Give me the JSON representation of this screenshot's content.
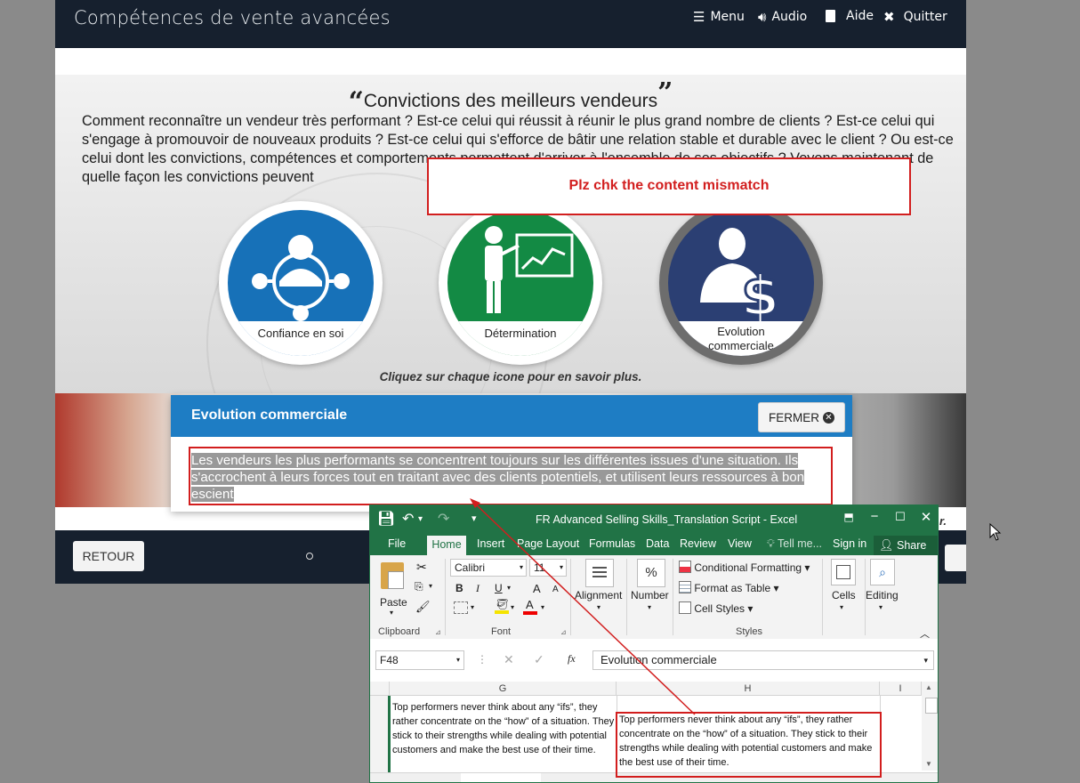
{
  "course": {
    "title": "Compétences de vente avancées",
    "nav": [
      {
        "icon": "list-icon",
        "label": "Menu"
      },
      {
        "icon": "speaker-icon",
        "label": "Audio"
      },
      {
        "icon": "book-icon",
        "label": "Aide"
      },
      {
        "icon": "close-x-icon",
        "label": "Quitter"
      }
    ]
  },
  "slide": {
    "title": "Convictions des meilleurs vendeurs",
    "quote_open": "“",
    "quote_close": "”",
    "body": "Comment reconnaître un vendeur très performant ? Est-ce celui qui réussit à réunir le plus grand nombre de clients ? Est-ce celui qui s'engage à promouvoir de nouveaux produits ? Est-ce celui qui s'efforce de bâtir une relation stable et durable avec le client ? Ou est-ce celui dont les convictions, compétences et comportements permettent d'arriver à l'ensemble de ses objectifs ? Voyons maintenant de quelle façon les convictions peuvent",
    "circles": [
      {
        "label": "Confiance en soi",
        "color": "#1771b8",
        "icon": "network-person-icon"
      },
      {
        "label": "Détermination",
        "color": "#138a44",
        "icon": "presenter-chart-icon"
      },
      {
        "label": "Evolution\ncommerciale",
        "color": "#2b3f73",
        "icon": "person-dollar-icon"
      }
    ],
    "hint": "Cliquez sur chaque icone pour en savoir plus.",
    "lower_suffix": "r."
  },
  "popup": {
    "title": "Evolution commerciale",
    "close_label": "FERMER",
    "body_highlighted": "Les vendeurs les plus performants se concentrent toujours sur les différentes issues d'une situation. Ils s'accrochent à leurs forces tout en traitant avec des clients potentiels, et utilisent leurs ressources à bon escient",
    "body_end": "."
  },
  "player_bottom": {
    "back_label": "RETOUR"
  },
  "annotation": {
    "note": "Plz chk the content mismatch",
    "colors": {
      "red": "#d21e1e"
    }
  },
  "excel": {
    "window_title": "FR Advanced Selling Skills_Translation Script - Excel",
    "tabs": [
      "File",
      "Home",
      "Insert",
      "Page Layout",
      "Formulas",
      "Data",
      "Review",
      "View",
      "Tell me...",
      "Sign in",
      "Share"
    ],
    "ribbon": {
      "clipboard": {
        "paste": "Paste",
        "group": "Clipboard"
      },
      "font": {
        "name": "Calibri",
        "size": "11",
        "bold": "B",
        "italic": "I",
        "underline": "U",
        "grow": "A",
        "shrink": "A",
        "font_color": "A",
        "group": "Font"
      },
      "alignment": {
        "label": "Alignment"
      },
      "number": {
        "label": "Number",
        "icon_text": "%"
      },
      "styles": {
        "conditional": "Conditional Formatting",
        "format_table": "Format as Table",
        "cell_styles": "Cell Styles",
        "group": "Styles"
      },
      "cells": {
        "label": "Cells"
      },
      "editing": {
        "label": "Editing"
      }
    },
    "name_box": "F48",
    "fx": "fx",
    "formula_value": "Evolution commerciale",
    "columns": [
      "G",
      "H",
      "I"
    ],
    "cell_g": "Top performers never think about any “ifs”, they rather concentrate on the “how” of a situation. They stick to their strengths while dealing with potential customers and make the best use of their time.",
    "cell_h": "Top performers never think about any “ifs”, they rather concentrate on the “how” of a situation. They stick to their strengths while dealing with potential customers and make the best use of their time."
  }
}
